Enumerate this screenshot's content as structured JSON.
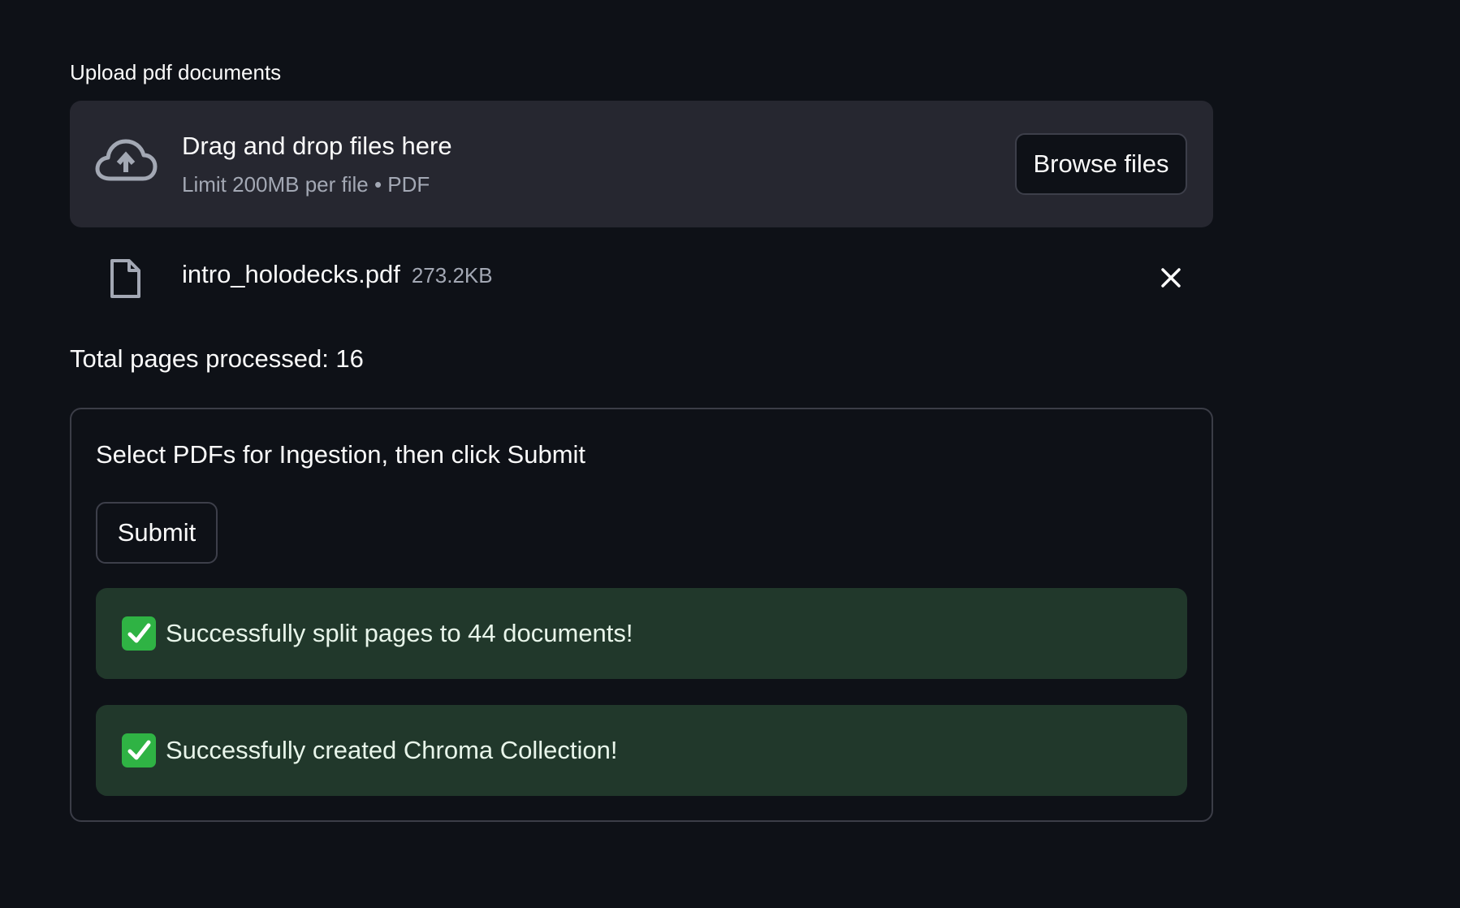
{
  "uploader": {
    "label": "Upload pdf documents",
    "dropzone_title": "Drag and drop files here",
    "dropzone_limit": "Limit 200MB per file • PDF",
    "browse_label": "Browse files",
    "icon": "cloud-upload-icon"
  },
  "files": [
    {
      "name": "intro_holodecks.pdf",
      "size": "273.2KB",
      "icon": "file-icon",
      "remove_icon": "close-icon"
    }
  ],
  "total_pages": "Total pages processed: 16",
  "form": {
    "title": "Select PDFs for Ingestion, then click Submit",
    "submit_label": "Submit",
    "alerts": [
      {
        "icon": "check-icon",
        "text": "Successfully split pages to 44 documents!"
      },
      {
        "icon": "check-icon",
        "text": "Successfully created Chroma Collection!"
      }
    ]
  },
  "colors": {
    "background": "#0e1117",
    "dropzone": "#262730",
    "success_bg": "#21382b",
    "success_check": "#2fb344",
    "muted_text": "#a3a8b4"
  }
}
